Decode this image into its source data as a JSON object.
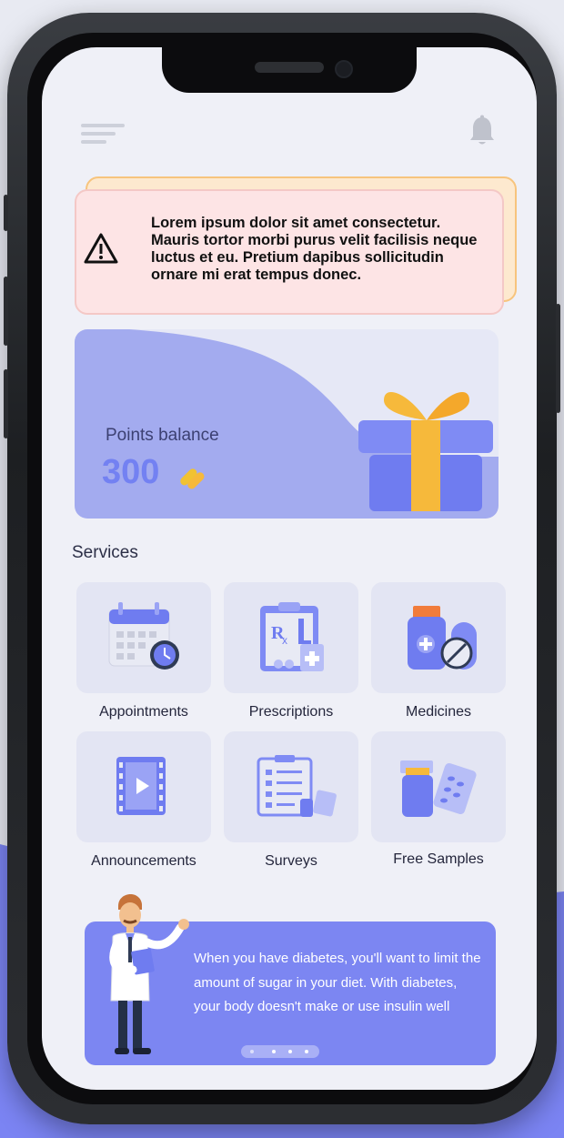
{
  "header": {
    "menu_icon": "hamburger-menu-icon",
    "notification_icon": "bell-icon"
  },
  "alert": {
    "icon": "warning-triangle-icon",
    "text": "Lorem ipsum dolor sit amet consectetur. Mauris tortor morbi purus velit facilisis neque luctus et eu. Pretium dapibus sollicitudin ornare mi erat tempus donec."
  },
  "points": {
    "label": "Points balance",
    "value": "300",
    "icon": "pills-icon",
    "illustration": "gift-box-icon"
  },
  "services": {
    "title": "Services",
    "items": [
      {
        "label": "Appointments",
        "icon": "calendar-clock-icon"
      },
      {
        "label": "Prescriptions",
        "icon": "prescription-clipboard-icon"
      },
      {
        "label": "Medicines",
        "icon": "medicine-bottle-icon"
      },
      {
        "label": "Announcements",
        "icon": "video-film-icon"
      },
      {
        "label": "Surveys",
        "icon": "survey-checklist-icon"
      },
      {
        "label": "Free Samples",
        "icon": "sample-pills-icon"
      }
    ]
  },
  "banner": {
    "text": "When you have diabetes, you'll want to limit the amount of sugar in your diet. With diabetes, your body doesn't make or use insulin well",
    "illustration": "doctor-illustration",
    "dots": 4,
    "active_dot": 0
  },
  "colors": {
    "accent": "#7c86f2",
    "background": "#eff0f7",
    "alert_bg": "#fde4e5",
    "points_value": "#7381f2",
    "gift_ribbon": "#f6b93b"
  }
}
